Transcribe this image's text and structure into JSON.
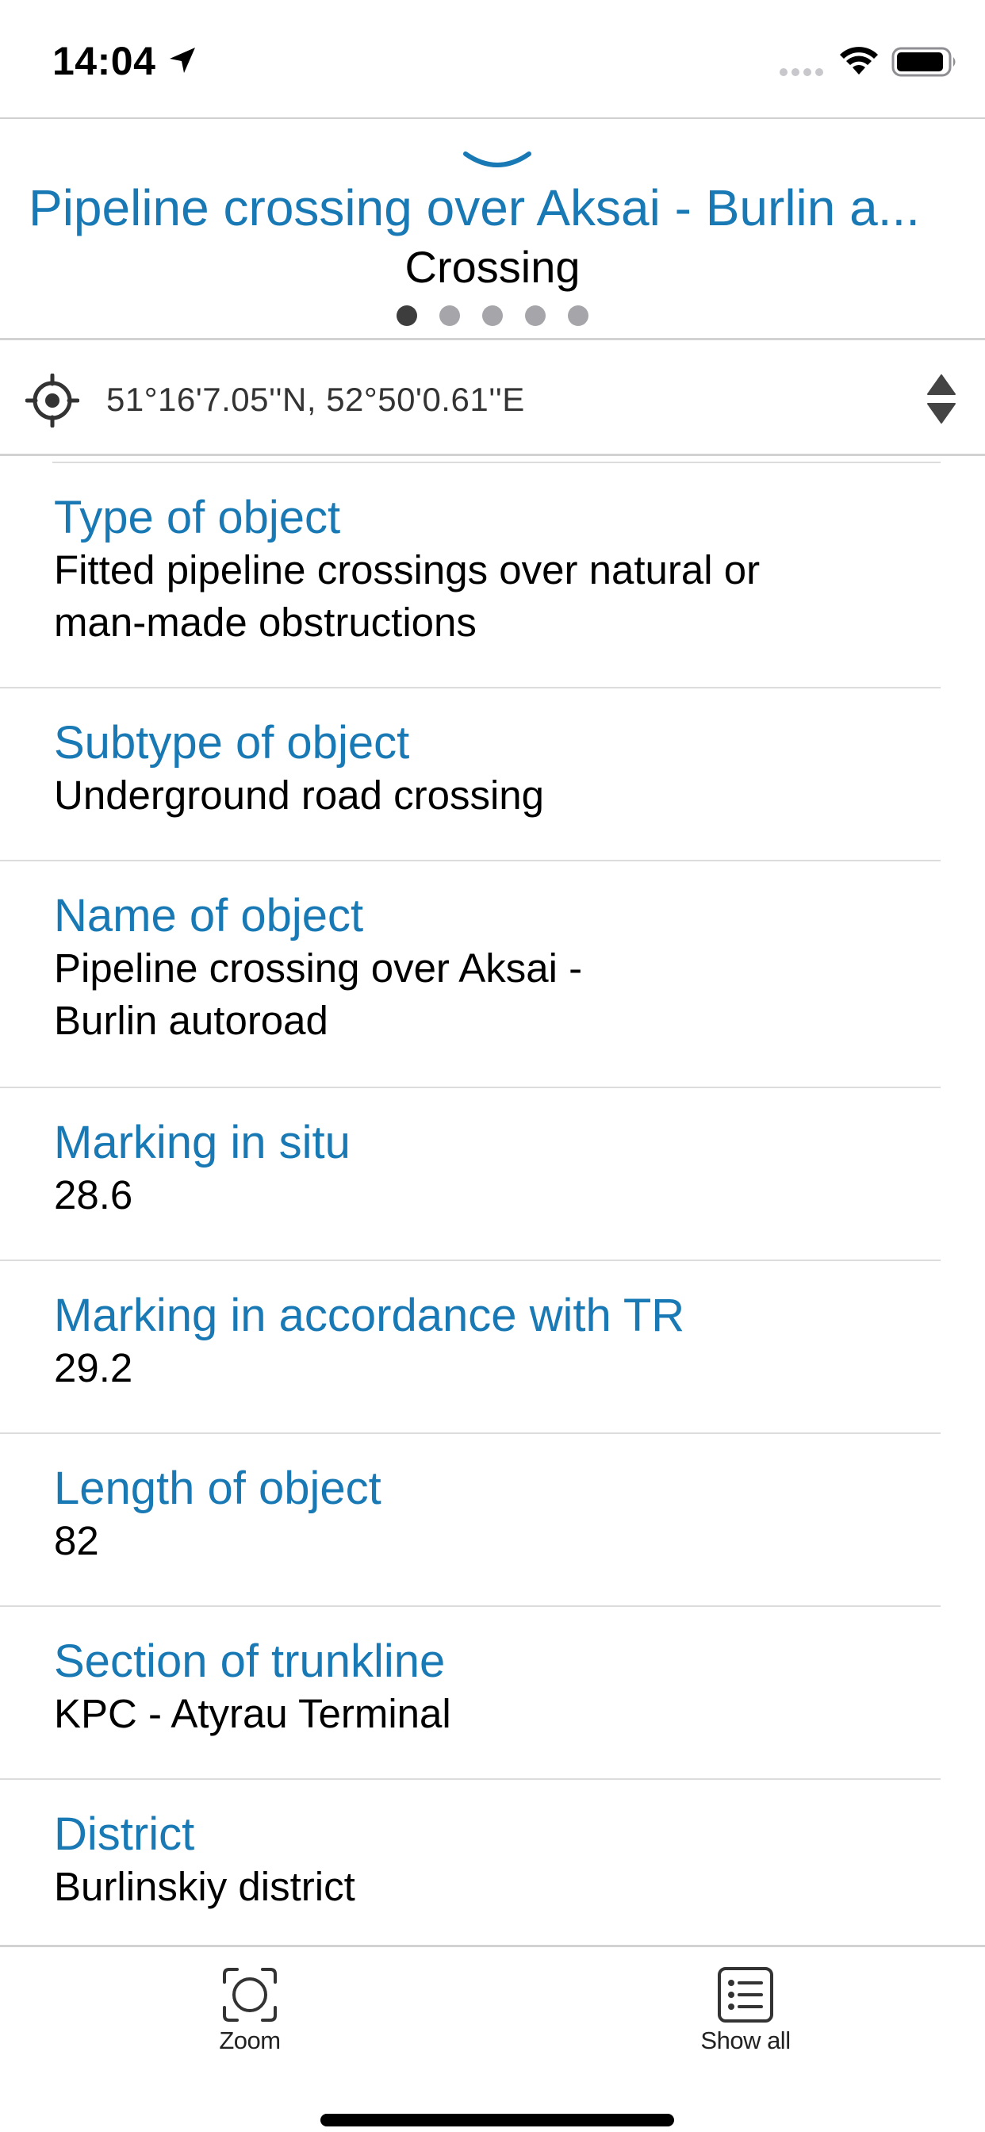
{
  "status_bar": {
    "time": "14:04"
  },
  "header": {
    "title": "Pipeline crossing over Aksai - Burlin a...",
    "subtitle": "Crossing",
    "page_count": 5,
    "active_page": 1
  },
  "coordinates": {
    "text": "51°16'7.05''N, 52°50'0.61''E"
  },
  "attributes": [
    {
      "label": "Type of object",
      "value_line1": "Fitted pipeline crossings over natural or",
      "value_line2": "man-made obstructions"
    },
    {
      "label": "Subtype of object",
      "value_line1": "Underground road crossing",
      "value_line2": ""
    },
    {
      "label": "Name of object",
      "value_line1": "Pipeline crossing over Aksai -",
      "value_line2": "Burlin autoroad"
    },
    {
      "label": "Marking in situ",
      "value_line1": "28.6",
      "value_line2": ""
    },
    {
      "label": "Marking in accordance with TR",
      "value_line1": "29.2",
      "value_line2": ""
    },
    {
      "label": "Length of object",
      "value_line1": "82",
      "value_line2": ""
    },
    {
      "label": "Section of trunkline",
      "value_line1": "KPC - Atyrau Terminal",
      "value_line2": ""
    },
    {
      "label": "District",
      "value_line1": "Burlinskiy district",
      "value_line2": ""
    }
  ],
  "toolbar": {
    "zoom_label": "Zoom",
    "show_all_label": "Show all"
  },
  "colors": {
    "accent": "#1879b5",
    "separator": "#dcdcdc"
  }
}
